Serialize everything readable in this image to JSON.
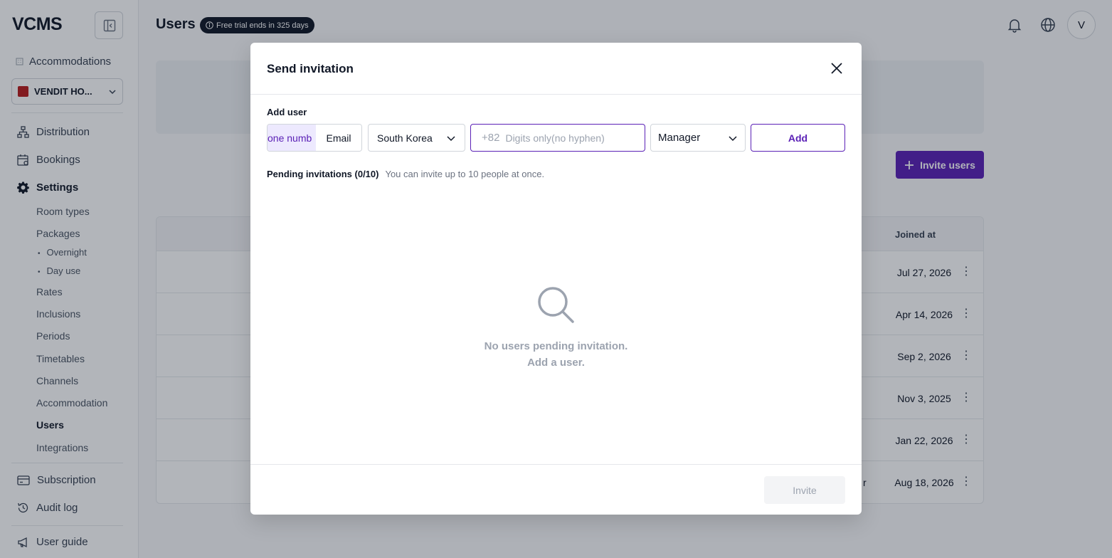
{
  "sidebar": {
    "logo": "VCMS",
    "accommodations_label": "Accommodations",
    "hotel_name": "VENDIT HO...",
    "nav": {
      "distribution": "Distribution",
      "bookings": "Bookings",
      "settings": "Settings",
      "subscription": "Subscription",
      "audit_log": "Audit log",
      "user_guide": "User guide"
    },
    "settings_items": {
      "room_types": "Room types",
      "packages": "Packages",
      "overnight": "Overnight",
      "day_use": "Day use",
      "rates": "Rates",
      "inclusions": "Inclusions",
      "periods": "Periods",
      "timetables": "Timetables",
      "channels": "Channels",
      "accommodation": "Accommodation",
      "users": "Users",
      "integrations": "Integrations"
    }
  },
  "header": {
    "title": "Users",
    "trial_badge": "Free trial ends in 325 days",
    "avatar_initial": "V"
  },
  "main": {
    "invite_users_label": "Invite users",
    "table": {
      "joined_header": "Joined at",
      "partial_cell": "r",
      "rows": [
        {
          "joined": "Jul 27, 2026"
        },
        {
          "joined": "Apr 14, 2026"
        },
        {
          "joined": "Sep 2, 2026"
        },
        {
          "joined": "Nov 3, 2025"
        },
        {
          "joined": "Jan 22, 2026"
        },
        {
          "joined": "Aug 18, 2026"
        }
      ]
    }
  },
  "modal": {
    "title": "Send invitation",
    "add_user_label": "Add user",
    "tab_phone": "one numb",
    "tab_email": "Email",
    "country": "South Korea",
    "phone_prefix": "+82",
    "phone_placeholder": "Digits only(no hyphen)",
    "phone_value": "",
    "role": "Manager",
    "add_label": "Add",
    "pending_title": "Pending invitations (0/10)",
    "pending_hint": "You can invite up to 10 people at once.",
    "empty_line1": "No users pending invitation.",
    "empty_line2": "Add a user.",
    "invite_label": "Invite"
  },
  "colors": {
    "accent": "#5b21b6",
    "accent_light": "#ede9fe",
    "badge_bg": "#111827"
  },
  "icons": [
    "collapse-sidebar-icon",
    "building-icon",
    "chevron-down-icon",
    "sitemap-icon",
    "calendar-icon",
    "gear-icon",
    "credit-card-icon",
    "history-icon",
    "megaphone-icon",
    "info-icon",
    "bell-icon",
    "globe-icon",
    "plus-icon",
    "kebab-icon",
    "close-icon",
    "search-icon"
  ]
}
